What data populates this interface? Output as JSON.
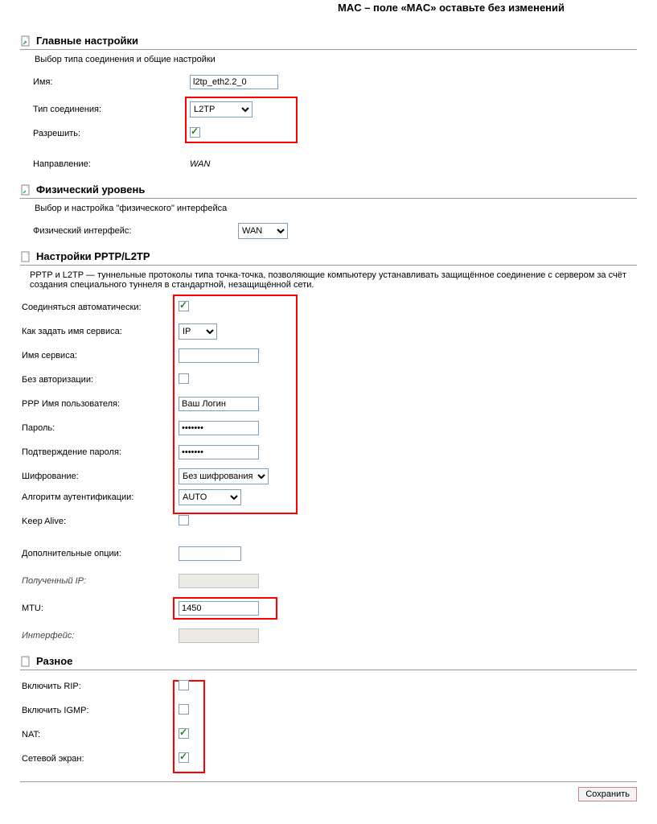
{
  "annotation": "MAC – поле «MAC» оставьте без изменений",
  "sections": {
    "main": {
      "title": "Главные настройки",
      "desc": "Выбор типа соединения и общие настройки",
      "name_label": "Имя:",
      "name_value": "l2tp_eth2.2_0",
      "conn_type_label": "Тип соединения:",
      "conn_type_value": "L2TP",
      "allow_label": "Разрешить:",
      "direction_label": "Направление:",
      "direction_value": "WAN"
    },
    "phys": {
      "title": "Физический уровень",
      "desc": "Выбор и настройка \"физического\" интерфейса",
      "iface_label": "Физический интерфейс:",
      "iface_value": "WAN"
    },
    "pptp": {
      "title": "Настройки PPTP/L2TP",
      "desc": "PPTP и L2TP — туннельные протоколы типа точка-точка, позволяющие компьютеру устанавливать защищённое соединение с сервером за счёт создания специального туннеля в стандартной, незащищённой сети.",
      "auto_label": "Соединяться автоматически:",
      "svc_mode_label": "Как задать имя сервиса:",
      "svc_mode_value": "IP",
      "svc_name_label": "Имя сервиса:",
      "svc_name_value": "",
      "noauth_label": "Без авторизации:",
      "ppp_user_label": "PPP Имя пользователя:",
      "ppp_user_value": "Ваш Логин",
      "pwd_label": "Пароль:",
      "pwd_value": "•••••••",
      "pwd2_label": "Подтверждение пароля:",
      "pwd2_value": "•••••••",
      "enc_label": "Шифрование:",
      "enc_value": "Без шифрования",
      "auth_label": "Алгоритм аутентификации:",
      "auth_value": "AUTO",
      "keepalive_label": "Keep Alive:",
      "extra_label": "Дополнительные опции:",
      "extra_value": "",
      "recv_ip_label": "Полученный IP:",
      "recv_ip_value": "",
      "mtu_label": "MTU:",
      "mtu_value": "1450",
      "iface_label": "Интерфейс:",
      "iface_value": ""
    },
    "misc": {
      "title": "Разное",
      "rip_label": "Включить RIP:",
      "igmp_label": "Включить IGMP:",
      "nat_label": "NAT:",
      "fw_label": "Сетевой экран:"
    }
  },
  "save_button": "Сохранить"
}
